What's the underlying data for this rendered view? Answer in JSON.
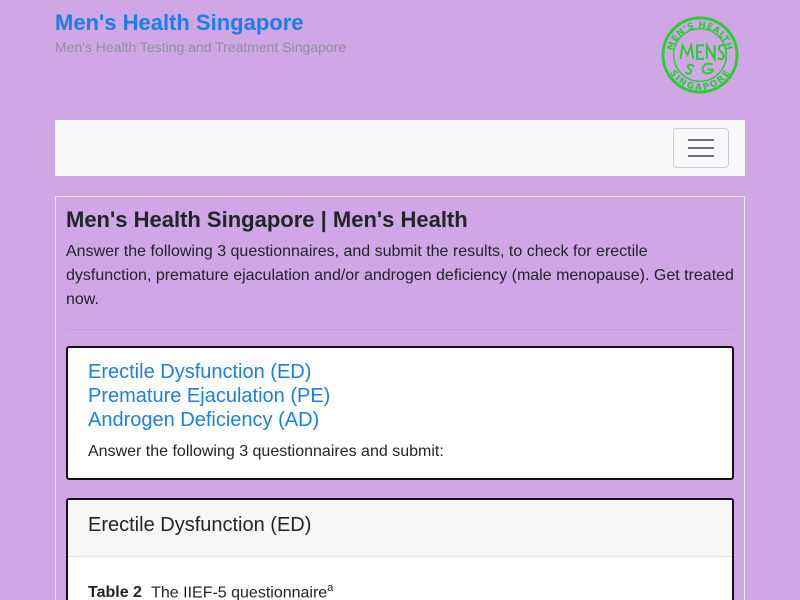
{
  "header": {
    "site_title": "Men's Health Singapore",
    "tagline": "Men's Health Testing and Treatment Singapore",
    "logo": {
      "top_text": "MEN'S HEALTH",
      "bottom_text": "SINGAPORE",
      "mark": "MENS SG",
      "color": "#22d12e"
    }
  },
  "navbar": {
    "toggler_icon": "hamburger-icon"
  },
  "main": {
    "title": "Men's Health Singapore | Men's Health",
    "intro": "Answer the following 3 questionnaires, and submit the results, to check for erectile dysfunction, premature ejaculation and/or androgen deficiency (male menopause). Get treated now.",
    "links": [
      "Erectile Dysfunction (ED)",
      "Premature Ejaculation (PE)",
      "Androgen Deficiency (AD)"
    ],
    "answer_text": "Answer the following 3 questionnaires and submit:",
    "ed_section": {
      "title": "Erectile Dysfunction (ED)",
      "table_label": "Table 2",
      "table_title": "The IIEF-5 questionnaire",
      "table_footnote": "a"
    }
  },
  "colors": {
    "background": "#d0a6e4",
    "link": "#1a7fe6",
    "navbar": "#f8f9fa"
  }
}
